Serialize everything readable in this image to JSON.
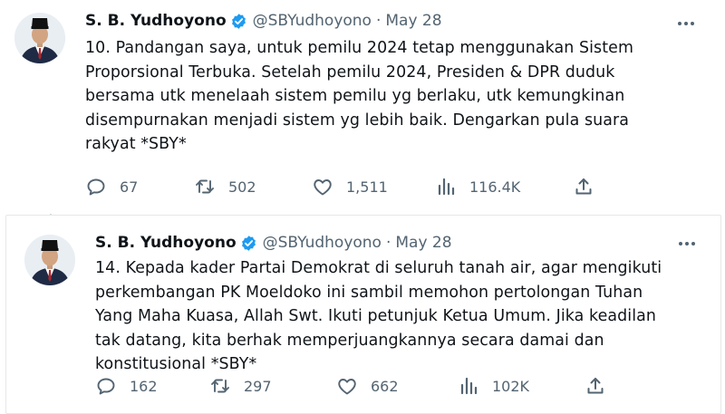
{
  "tweets": [
    {
      "name": "S. B. Yudhoyono",
      "handle": "@SBYudhoyono",
      "separator": "·",
      "date": "May 28",
      "body_lines": [
        "10. Pandangan saya, untuk pemilu 2024 tetap menggunakan Sistem",
        "Proporsional Terbuka. Setelah pemilu 2024, Presiden & DPR duduk",
        "bersama utk menelaah sistem pemilu yg berlaku, utk kemungkinan",
        "disempurnakan menjadi sistem yg lebih baik. Dengarkan pula suara",
        "rakyat *SBY*"
      ],
      "replies": "67",
      "retweets": "502",
      "likes": "1,511",
      "views": "116.4K"
    },
    {
      "name": "S. B. Yudhoyono",
      "handle": "@SBYudhoyono",
      "separator": "·",
      "date": "May 28",
      "body_lines": [
        "14. Kepada kader Partai Demokrat di seluruh tanah air, agar mengikuti",
        "perkembangan PK Moeldoko ini sambil memohon pertolongan Tuhan",
        "Yang Maha Kuasa, Allah Swt. Ikuti petunjuk Ketua Umum. Jika keadilan",
        "tak datang, kita berhak memperjuangkannya secara damai dan",
        "konstitusional *SBY*"
      ],
      "replies": "162",
      "retweets": "297",
      "likes": "662",
      "views": "102K"
    }
  ],
  "colors": {
    "text": "#0f1419",
    "muted": "#536471",
    "verified": "#1d9bf0",
    "border": "#e7e7e7"
  },
  "icons": [
    "verified-badge-icon",
    "more-icon",
    "reply-icon",
    "retweet-icon",
    "like-icon",
    "views-icon",
    "share-icon"
  ]
}
